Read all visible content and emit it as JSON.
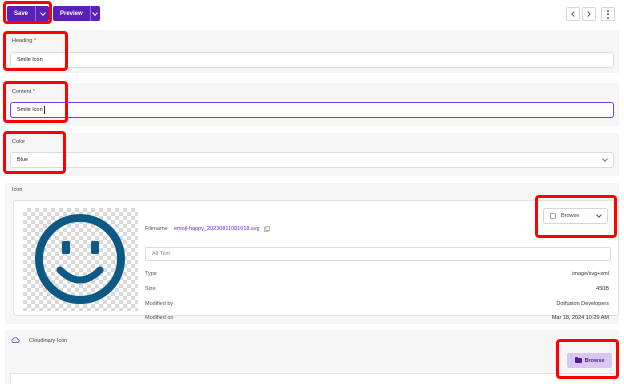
{
  "toolbar": {
    "save_label": "Save",
    "preview_label": "Preview"
  },
  "heading": {
    "label": "Heading",
    "required_mark": "*",
    "value": "Smile Icon"
  },
  "content": {
    "label": "Content",
    "required_mark": "*",
    "value": "Smile Icon"
  },
  "color": {
    "label": "Color",
    "value": "Blue"
  },
  "icon": {
    "label": "Icon",
    "filename_label": "Filename",
    "filename": "emoji-happy_20230811081618.svg",
    "alt_placeholder": "Alt Text",
    "browse_label": "Browse",
    "smiley_color": "#0b5a86",
    "meta": [
      {
        "label": "Type",
        "value": "image/svg+xml"
      },
      {
        "label": "Size",
        "value": "450B"
      },
      {
        "label": "Modified by",
        "value": "Dotfusion Developers"
      },
      {
        "label": "Modified on",
        "value": "Mar 18, 2024 10:29 AM"
      }
    ]
  },
  "cloudinary": {
    "label": "Cloudinary Icon",
    "browse_label": "Browse"
  },
  "colors": {
    "accent": "#5b21b6",
    "annotation": "#ff0000"
  }
}
